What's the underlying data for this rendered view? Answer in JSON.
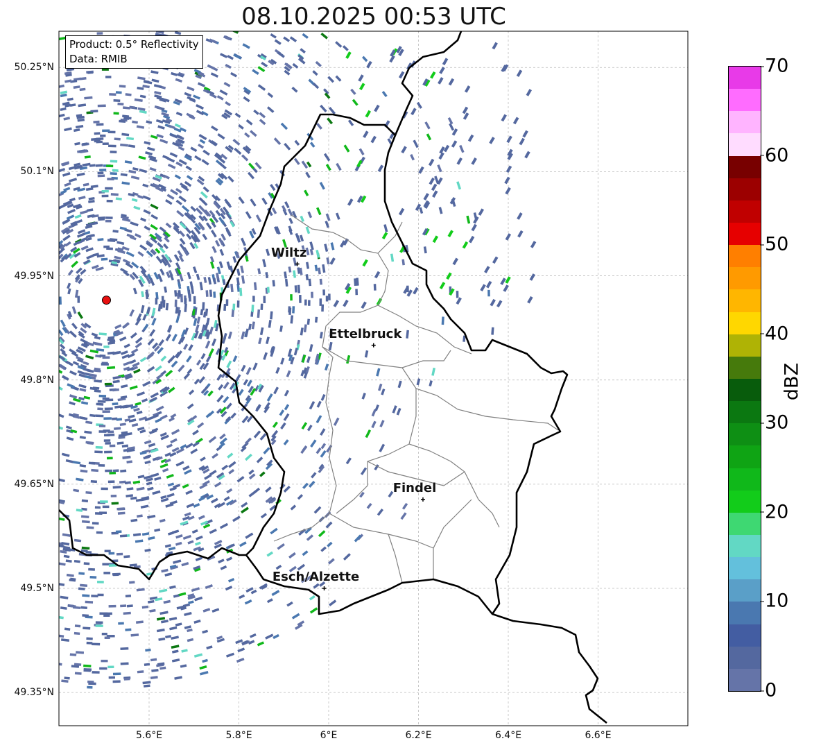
{
  "title": "08.10.2025 00:53 UTC",
  "legend": {
    "product": "Product: 0.5° Reflectivity",
    "data": "Data: RMIB"
  },
  "map": {
    "lon_range": [
      5.4,
      6.8
    ],
    "lat_range": [
      49.3,
      50.3
    ],
    "lon_ticks": [
      {
        "v": 5.6,
        "label": "5.6°E"
      },
      {
        "v": 5.8,
        "label": "5.8°E"
      },
      {
        "v": 6.0,
        "label": "6°E"
      },
      {
        "v": 6.2,
        "label": "6.2°E"
      },
      {
        "v": 6.4,
        "label": "6.4°E"
      },
      {
        "v": 6.6,
        "label": "6.6°E"
      }
    ],
    "lat_ticks": [
      {
        "v": 50.25,
        "label": "50.25°N"
      },
      {
        "v": 50.1,
        "label": "50.1°N"
      },
      {
        "v": 49.95,
        "label": "49.95°N"
      },
      {
        "v": 49.8,
        "label": "49.8°N"
      },
      {
        "v": 49.65,
        "label": "49.65°N"
      },
      {
        "v": 49.5,
        "label": "49.5°N"
      },
      {
        "v": 49.35,
        "label": "49.35°N"
      }
    ],
    "cities": [
      {
        "name": "Wiltz",
        "lon": 5.93,
        "lat": 49.967
      },
      {
        "name": "Ettelbruck",
        "lon": 6.1,
        "lat": 49.85
      },
      {
        "name": "Findel",
        "lon": 6.21,
        "lat": 49.628
      },
      {
        "name": "Esch/Alzette",
        "lon": 5.99,
        "lat": 49.5
      }
    ],
    "radar_site": {
      "lon": 5.505,
      "lat": 49.915,
      "color": "#e81010"
    }
  },
  "colorbar": {
    "label": "dBZ",
    "min": 0,
    "max": 70,
    "step": 2.5,
    "ticks": [
      "0",
      "10",
      "20",
      "30",
      "40",
      "50",
      "60",
      "70"
    ],
    "colors": [
      "#6574a8",
      "#54689f",
      "#435da2",
      "#4a78b0",
      "#5a9fc8",
      "#63c0dc",
      "#62d8c4",
      "#3ed872",
      "#12cc1a",
      "#10b81a",
      "#0fa414",
      "#0e8f14",
      "#0b7811",
      "#085c0c",
      "#467a0c",
      "#afb305",
      "#ffd700",
      "#ffb600",
      "#ff9a00",
      "#ff7f00",
      "#e60000",
      "#c00000",
      "#9c0000",
      "#780000",
      "#ffdcff",
      "#ffb4ff",
      "#ff6cff",
      "#e83ae8"
    ]
  }
}
